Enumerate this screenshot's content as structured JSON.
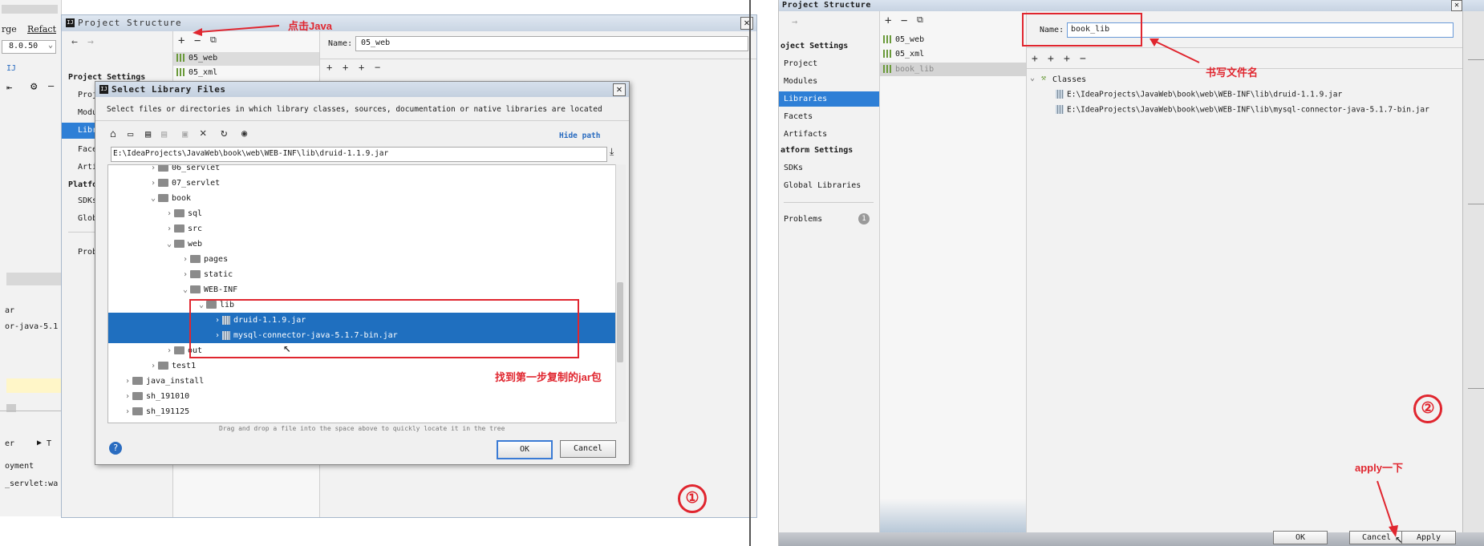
{
  "left": {
    "ide_menu": {
      "item1": "rge",
      "item2": "Refact",
      "version": "8.0.50"
    },
    "ide_fragments": {
      "ar": "ar",
      "connector": "or-java-5.1",
      "tab": "er",
      "tab2": "T",
      "deployment": "oyment",
      "servlet": "_servlet:wa"
    },
    "window_title": "Project Structure",
    "sidebar": {
      "heading": "Project Settings",
      "items": [
        "Proj",
        "Modu",
        "Libr",
        "Face",
        "Arti"
      ],
      "platform_heading": "Platfo",
      "platform_items": [
        "SDKs",
        "Glob"
      ],
      "problems": "Prob"
    },
    "libraries": [
      "05_web",
      "05_xml"
    ],
    "name_label": "Name:",
    "name_value": "05_web",
    "dialog": {
      "title": "Select Library Files",
      "description": "Select files or directories in which library classes, sources, documentation or native libraries are located",
      "hide_path": "Hide path",
      "path": "E:\\IdeaProjects\\JavaWeb\\book\\web\\WEB-INF\\lib\\druid-1.1.9.jar",
      "tree": [
        "06_servlet",
        "07_servlet",
        "book",
        "sql",
        "src",
        "web",
        "pages",
        "static",
        "WEB-INF",
        "lib",
        "druid-1.1.9.jar",
        "mysql-connector-java-5.1.7-bin.jar",
        "out",
        "test1",
        "java_install",
        "sh_191010",
        "sh_191125"
      ],
      "hint": "Drag and drop a file into the space above to quickly locate it in the tree",
      "help": "?",
      "ok": "OK",
      "cancel": "Cancel"
    },
    "annotations": {
      "click_java": "点击Java",
      "find_jar": "找到第一步复制的jar包",
      "step": "①"
    }
  },
  "right": {
    "window_title": "Project Structure",
    "sidebar": {
      "heading": "oject Settings",
      "items": [
        "Project",
        "Modules",
        "Libraries",
        "Facets",
        "Artifacts"
      ],
      "platform_heading": "atform Settings",
      "platform_items": [
        "SDKs",
        "Global Libraries"
      ],
      "problems": "Problems",
      "problems_count": "1"
    },
    "libraries": [
      "05_web",
      "05_xml",
      "book_lib"
    ],
    "name_label": "Name:",
    "name_value": "book_lib",
    "classes_label": "Classes",
    "jars": [
      "E:\\IdeaProjects\\JavaWeb\\book\\web\\WEB-INF\\lib\\druid-1.1.9.jar",
      "E:\\IdeaProjects\\JavaWeb\\book\\web\\WEB-INF\\lib\\mysql-connector-java-5.1.7-bin.jar"
    ],
    "buttons": {
      "ok": "OK",
      "cancel": "Cancel",
      "apply": "Apply"
    },
    "annotations": {
      "write_name": "书写文件名",
      "apply_once": "apply一下",
      "step": "②"
    }
  },
  "colors": {
    "annotation_red": "#e0262f",
    "selection_blue": "#1f6fbf",
    "sidebar_selected": "#2e7fd6"
  }
}
